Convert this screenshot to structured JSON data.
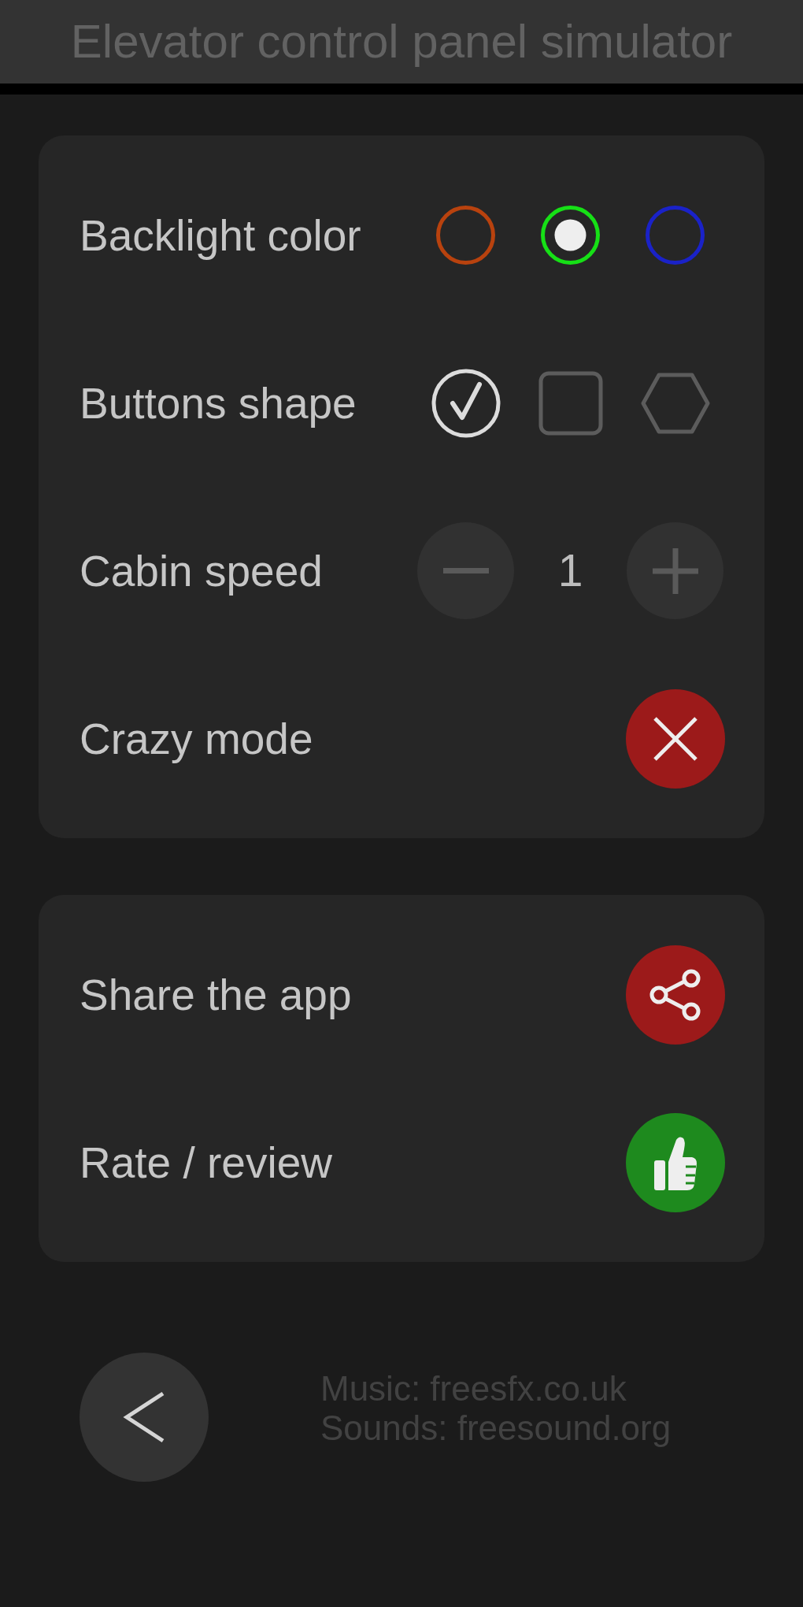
{
  "header": {
    "title": "Elevator control panel simulator"
  },
  "settings": [
    {
      "kind": "color_picker",
      "label": "Backlight color",
      "options": [
        {
          "color": "#b8420e",
          "selected": false
        },
        {
          "color": "#16e016",
          "selected": true
        },
        {
          "color": "#1a22c8",
          "selected": false
        }
      ]
    },
    {
      "kind": "shape_picker",
      "label": "Buttons shape",
      "options": [
        {
          "kind": "circle",
          "selected": true
        },
        {
          "kind": "square",
          "selected": false
        },
        {
          "kind": "hexagon",
          "selected": false
        }
      ]
    },
    {
      "kind": "stepper",
      "label": "Cabin speed",
      "value": "1"
    },
    {
      "kind": "toggle",
      "label": "Crazy mode",
      "on": false
    }
  ],
  "actions": [
    {
      "kind": "share",
      "label": "Share the app"
    },
    {
      "kind": "rate",
      "label": "Rate / review"
    }
  ],
  "footer": {
    "credits": [
      "Music: freesfx.co.uk",
      "Sounds: freesound.org"
    ]
  }
}
